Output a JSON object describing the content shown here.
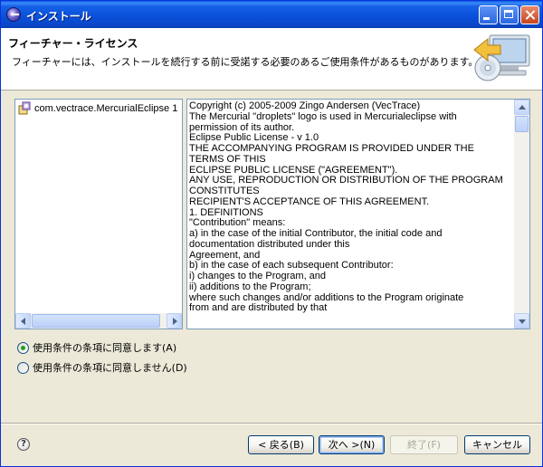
{
  "window": {
    "title": "インストール"
  },
  "banner": {
    "title": "フィーチャー・ライセンス",
    "description": "フィーチャーには、インストールを続行する前に受諾する必要のあるご使用条件があるものがあります。"
  },
  "features": {
    "items": [
      {
        "label": "com.vectrace.MercurialEclipse 1"
      }
    ]
  },
  "license": {
    "lines": [
      "Copyright (c) 2005-2009 Zingo Andersen (VecTrace)",
      "The Mercurial \"droplets\" logo is used in Mercurialeclipse with",
      "permission of its author.",
      "Eclipse Public License - v 1.0",
      "THE ACCOMPANYING PROGRAM IS PROVIDED UNDER THE",
      "TERMS OF THIS",
      "ECLIPSE PUBLIC LICENSE (\"AGREEMENT\").",
      "ANY USE, REPRODUCTION OR DISTRIBUTION OF THE PROGRAM",
      "CONSTITUTES",
      "RECIPIENT'S ACCEPTANCE OF THIS AGREEMENT.",
      "1. DEFINITIONS",
      "\"Contribution\" means:",
      "a) in the case of the initial Contributor, the initial code and",
      "documentation distributed under this",
      "Agreement, and",
      "b) in the case of each subsequent Contributor:",
      "i) changes to the Program, and",
      "ii) additions to the Program;",
      "where such changes and/or additions to the Program originate",
      "from and are distributed by that"
    ]
  },
  "radios": {
    "accept": {
      "label": "使用条件の条項に同意します(A)",
      "checked": true
    },
    "decline": {
      "label": "使用条件の条項に同意しません(D)",
      "checked": false
    }
  },
  "buttons": {
    "back": "< 戻る(B)",
    "next": "次へ >(N)",
    "finish": "終了(F)",
    "cancel": "キャンセル"
  },
  "colors": {
    "titlebar": "#0a4fd8",
    "dialog_bg": "#ece9d8",
    "border": "#7f9db9"
  }
}
